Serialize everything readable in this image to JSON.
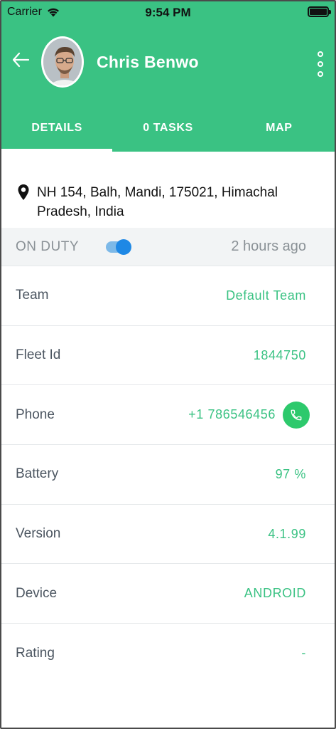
{
  "status_bar": {
    "carrier": "Carrier",
    "time": "9:54 PM"
  },
  "header": {
    "driver_name": "Chris Benwo"
  },
  "tabs": [
    {
      "label": "DETAILS",
      "active": true
    },
    {
      "label": "0 TASKS",
      "active": false
    },
    {
      "label": "MAP",
      "active": false
    }
  ],
  "address": "NH 154, Balh, Mandi, 175021, Himachal Pradesh, India",
  "duty": {
    "label": "ON DUTY",
    "toggle_on": true,
    "last_seen": "2 hours ago"
  },
  "details": {
    "team": {
      "label": "Team",
      "value": "Default Team"
    },
    "fleet_id": {
      "label": "Fleet Id",
      "value": "1844750"
    },
    "phone": {
      "label": "Phone",
      "value": "+1 786546456"
    },
    "battery": {
      "label": "Battery",
      "value": "97 %"
    },
    "version": {
      "label": "Version",
      "value": "4.1.99"
    },
    "device": {
      "label": "Device",
      "value": "ANDROID"
    },
    "rating": {
      "label": "Rating",
      "value": "-"
    }
  },
  "colors": {
    "brand_green": "#3ac283",
    "toggle_blue": "#1e88e5",
    "call_green": "#2dc96c"
  },
  "icons": [
    "back-arrow-icon",
    "more-vertical-icon",
    "location-pin-icon",
    "phone-icon",
    "wifi-icon",
    "battery-icon"
  ]
}
